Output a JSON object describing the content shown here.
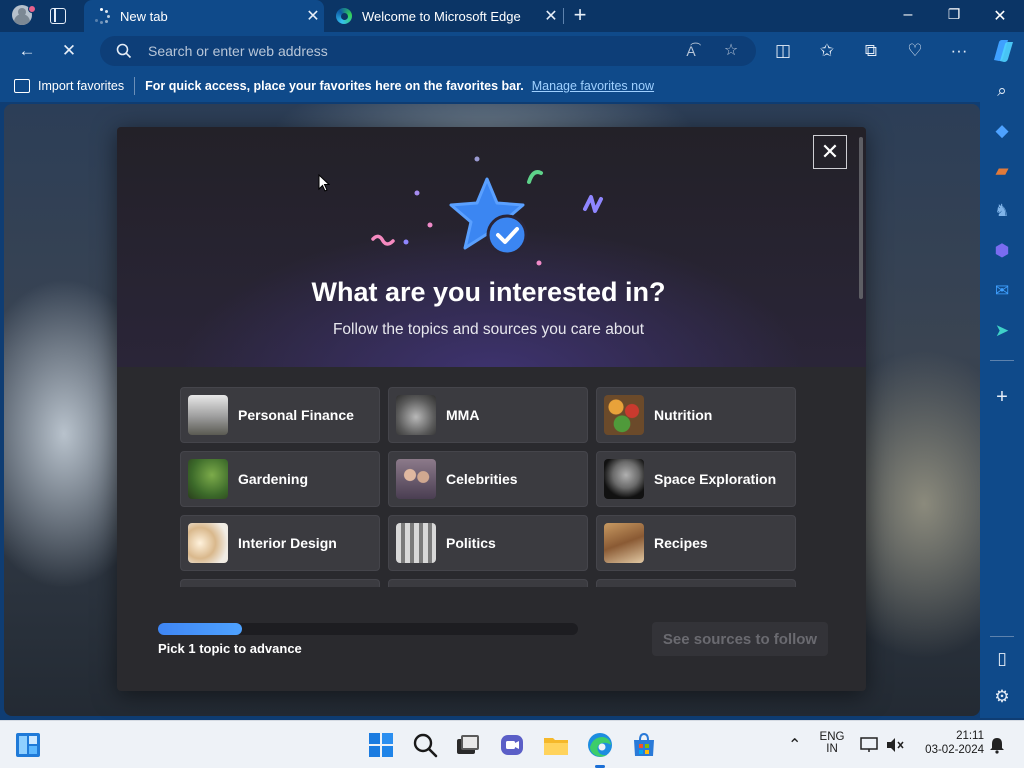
{
  "tabs": [
    {
      "title": "New tab",
      "active": true
    },
    {
      "title": "Welcome to Microsoft Edge",
      "active": false
    }
  ],
  "window_controls": {
    "minimize": "–",
    "restore": "❐",
    "close": "✕"
  },
  "address_bar": {
    "placeholder": "Search or enter web address",
    "value": ""
  },
  "favorites_bar": {
    "import_label": "Import favorites",
    "message": "For quick access, place your favorites here on the favorites bar.",
    "manage_link": "Manage favorites now"
  },
  "modal": {
    "title": "What are you interested in?",
    "subtitle": "Follow the topics and sources you care about",
    "topics": [
      {
        "label": "Personal Finance"
      },
      {
        "label": "MMA"
      },
      {
        "label": "Nutrition"
      },
      {
        "label": "Gardening"
      },
      {
        "label": "Celebrities"
      },
      {
        "label": "Space Exploration"
      },
      {
        "label": "Interior Design"
      },
      {
        "label": "Politics"
      },
      {
        "label": "Recipes"
      }
    ],
    "progress_fraction": 0.2,
    "progress_label": "Pick 1 topic to advance",
    "next_button": "See sources to follow"
  },
  "taskbar": {
    "language_line1": "ENG",
    "language_line2": "IN",
    "time": "21:11",
    "date": "03-02-2024"
  },
  "colors": {
    "accent": "#0f4a8a",
    "progress": "#3f86f4"
  }
}
